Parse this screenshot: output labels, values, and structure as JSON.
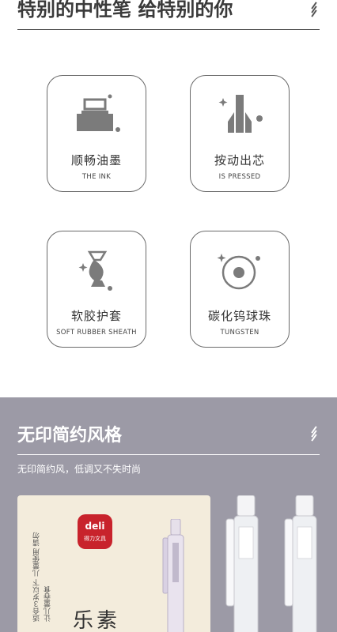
{
  "header": {
    "title": "特别的中性笔 给特别的你"
  },
  "features": [
    {
      "label": "顺畅油墨",
      "sublabel": "THE INK",
      "icon": "ink-bottle-icon"
    },
    {
      "label": "按动出芯",
      "sublabel": "IS PRESSED",
      "icon": "pen-tip-icon"
    },
    {
      "label": "软胶护套",
      "sublabel": "SOFT RUBBER SHEATH",
      "icon": "rubber-sheath-icon"
    },
    {
      "label": "碳化钨球珠",
      "sublabel": "TUNGSTEN",
      "icon": "tungsten-ball-icon"
    }
  ],
  "section": {
    "title": "无印简约风格",
    "subtitle": "无印简约风，低调又不失时尚"
  },
  "product": {
    "logo_top": "deli",
    "logo_bottom": "得力文具",
    "box_text": "适合３岁以下 儿童使用 请勿让儿童吞食",
    "box_brand": "乐素"
  },
  "colors": {
    "section_bg": "#9c9aa6",
    "logo_red": "#c8232c",
    "box_cream": "#f3ecdc",
    "card_border": "#6a6a6a",
    "icon_gray": "#7b7b7b"
  }
}
